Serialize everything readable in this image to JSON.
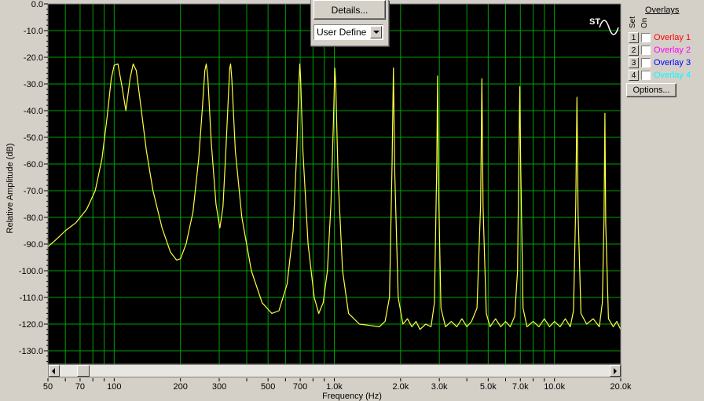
{
  "chart_data": {
    "type": "line",
    "title": "",
    "xlabel": "Frequency (Hz)",
    "ylabel": "Relative Amplitude (dB)",
    "x_scale": "log",
    "xlim": [
      50,
      20000
    ],
    "ylim": [
      -135,
      0
    ],
    "grid": true,
    "background": "#000000",
    "grid_color": "#00a000",
    "line_color": "#ffff40",
    "x_tick_labels": [
      {
        "v": 50,
        "t": "50"
      },
      {
        "v": 70,
        "t": "70"
      },
      {
        "v": 100,
        "t": "100"
      },
      {
        "v": 200,
        "t": "200"
      },
      {
        "v": 300,
        "t": "300"
      },
      {
        "v": 500,
        "t": "500"
      },
      {
        "v": 700,
        "t": "700"
      },
      {
        "v": 1000,
        "t": "1.0k"
      },
      {
        "v": 2000,
        "t": "2.0k"
      },
      {
        "v": 3000,
        "t": "3.0k"
      },
      {
        "v": 5000,
        "t": "5.0k"
      },
      {
        "v": 7000,
        "t": "7.0k"
      },
      {
        "v": 10000,
        "t": "10.0k"
      },
      {
        "v": 20000,
        "t": "20.0k"
      }
    ],
    "y_tick_labels": [
      {
        "v": 0,
        "t": "0.0"
      },
      {
        "v": -10,
        "t": "-10.0"
      },
      {
        "v": -20,
        "t": "-20.0"
      },
      {
        "v": -30,
        "t": "-30.0"
      },
      {
        "v": -40,
        "t": "-40.0"
      },
      {
        "v": -50,
        "t": "-50.0"
      },
      {
        "v": -60,
        "t": "-60.0"
      },
      {
        "v": -70,
        "t": "-70.0"
      },
      {
        "v": -80,
        "t": "-80.0"
      },
      {
        "v": -90,
        "t": "-90.0"
      },
      {
        "v": -100,
        "t": "-100.0"
      },
      {
        "v": -110,
        "t": "-110.0"
      },
      {
        "v": -120,
        "t": "-120.0"
      },
      {
        "v": -130,
        "t": "-130.0"
      }
    ],
    "series": [
      {
        "points": [
          [
            50,
            -91
          ],
          [
            55,
            -88
          ],
          [
            60,
            -85
          ],
          [
            67,
            -82
          ],
          [
            75,
            -77
          ],
          [
            82,
            -70
          ],
          [
            88,
            -58
          ],
          [
            93,
            -42
          ],
          [
            97,
            -28
          ],
          [
            100,
            -23
          ],
          [
            104,
            -22.5
          ],
          [
            108,
            -30
          ],
          [
            113,
            -40
          ],
          [
            118,
            -28
          ],
          [
            122,
            -22.5
          ],
          [
            126,
            -25
          ],
          [
            132,
            -38
          ],
          [
            140,
            -55
          ],
          [
            150,
            -70
          ],
          [
            165,
            -84
          ],
          [
            180,
            -93
          ],
          [
            192,
            -96
          ],
          [
            200,
            -95.5
          ],
          [
            212,
            -90
          ],
          [
            228,
            -78
          ],
          [
            242,
            -58
          ],
          [
            252,
            -38
          ],
          [
            258,
            -25
          ],
          [
            262,
            -22.5
          ],
          [
            266,
            -27
          ],
          [
            276,
            -52
          ],
          [
            290,
            -75
          ],
          [
            302,
            -84
          ],
          [
            312,
            -76
          ],
          [
            322,
            -54
          ],
          [
            330,
            -35
          ],
          [
            335,
            -24
          ],
          [
            338,
            -22.5
          ],
          [
            342,
            -28
          ],
          [
            355,
            -55
          ],
          [
            380,
            -80
          ],
          [
            420,
            -100
          ],
          [
            470,
            -112
          ],
          [
            520,
            -116
          ],
          [
            560,
            -115
          ],
          [
            610,
            -105
          ],
          [
            650,
            -85
          ],
          [
            675,
            -55
          ],
          [
            690,
            -30
          ],
          [
            697,
            -22.5
          ],
          [
            703,
            -28
          ],
          [
            720,
            -55
          ],
          [
            760,
            -90
          ],
          [
            810,
            -110
          ],
          [
            850,
            -116
          ],
          [
            890,
            -112
          ],
          [
            930,
            -100
          ],
          [
            965,
            -75
          ],
          [
            990,
            -45
          ],
          [
            1005,
            -24
          ],
          [
            1015,
            -30
          ],
          [
            1040,
            -65
          ],
          [
            1090,
            -100
          ],
          [
            1160,
            -116
          ],
          [
            1300,
            -120
          ],
          [
            1450,
            -120.5
          ],
          [
            1600,
            -121
          ],
          [
            1700,
            -119
          ],
          [
            1780,
            -110
          ],
          [
            1830,
            -60
          ],
          [
            1855,
            -24
          ],
          [
            1880,
            -62
          ],
          [
            1950,
            -110
          ],
          [
            2050,
            -120
          ],
          [
            2150,
            -118
          ],
          [
            2250,
            -121
          ],
          [
            2350,
            -119
          ],
          [
            2450,
            -122
          ],
          [
            2600,
            -120
          ],
          [
            2750,
            -121
          ],
          [
            2850,
            -112
          ],
          [
            2920,
            -60
          ],
          [
            2945,
            -27
          ],
          [
            2970,
            -65
          ],
          [
            3050,
            -114
          ],
          [
            3200,
            -121
          ],
          [
            3400,
            -119
          ],
          [
            3600,
            -121
          ],
          [
            3800,
            -118
          ],
          [
            4000,
            -121
          ],
          [
            4200,
            -119
          ],
          [
            4450,
            -114
          ],
          [
            4620,
            -75
          ],
          [
            4680,
            -28
          ],
          [
            4740,
            -76
          ],
          [
            4900,
            -116
          ],
          [
            5100,
            -121
          ],
          [
            5400,
            -118
          ],
          [
            5700,
            -121
          ],
          [
            6000,
            -119
          ],
          [
            6300,
            -121
          ],
          [
            6600,
            -117
          ],
          [
            6800,
            -100
          ],
          [
            6900,
            -55
          ],
          [
            6960,
            -31
          ],
          [
            7020,
            -58
          ],
          [
            7200,
            -114
          ],
          [
            7500,
            -121
          ],
          [
            8000,
            -119
          ],
          [
            8500,
            -121
          ],
          [
            9000,
            -118
          ],
          [
            9500,
            -121
          ],
          [
            10000,
            -119
          ],
          [
            10600,
            -121
          ],
          [
            11200,
            -118
          ],
          [
            11800,
            -121
          ],
          [
            12200,
            -115
          ],
          [
            12500,
            -75
          ],
          [
            12650,
            -35
          ],
          [
            12800,
            -78
          ],
          [
            13200,
            -116
          ],
          [
            14000,
            -120
          ],
          [
            15000,
            -118
          ],
          [
            16000,
            -121
          ],
          [
            16500,
            -112
          ],
          [
            16800,
            -80
          ],
          [
            16950,
            -41
          ],
          [
            17100,
            -82
          ],
          [
            17600,
            -118
          ],
          [
            18500,
            -121
          ],
          [
            19200,
            -119
          ],
          [
            20000,
            -122
          ]
        ]
      }
    ]
  },
  "popup": {
    "details_label": "Details...",
    "select_value": "User Define"
  },
  "overlays": {
    "title": "Overlays",
    "set_header": "Set",
    "on_header": "On",
    "items": [
      {
        "set": "1",
        "label": "Overlay 1",
        "color": "#ff0000"
      },
      {
        "set": "2",
        "label": "Overlay 2",
        "color": "#ff00ff"
      },
      {
        "set": "3",
        "label": "Overlay 3",
        "color": "#0000ff"
      },
      {
        "set": "4",
        "label": "Overlay 4",
        "color": "#00ffff"
      }
    ],
    "options_label": "Options..."
  },
  "logo_text": "ST"
}
